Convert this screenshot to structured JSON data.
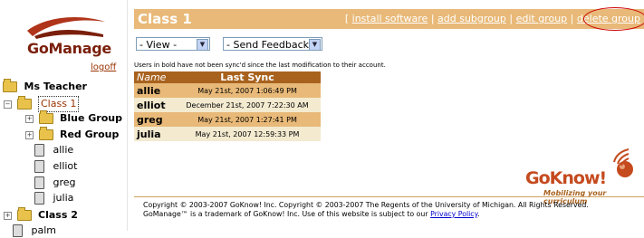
{
  "sidebar": {
    "brand": "GoManage",
    "logoff": "logoff",
    "tree": {
      "root": "Ms Teacher",
      "class1": "Class 1",
      "blue_group": "Blue Group",
      "red_group": "Red Group",
      "students": [
        "allie",
        "elliot",
        "greg",
        "julia"
      ],
      "class2": "Class 2",
      "palm": "palm"
    }
  },
  "header": {
    "title": "Class 1",
    "links": [
      "install software",
      "add subgroup",
      "edit group",
      "delete group"
    ],
    "separator": "|",
    "open_bracket": "[",
    "colors": {
      "bar": "#e8b978",
      "highlight_circle": "#cc0000"
    }
  },
  "controls": {
    "view_select": "- View -",
    "feedback_select": "- Send Feedback -"
  },
  "note": "Users in bold have not been sync'd since the last modification to their account.",
  "table": {
    "headers": [
      "Name",
      "Last Sync"
    ],
    "rows": [
      {
        "name": "allie",
        "last_sync": "May 21st, 2007 1:06:49 PM"
      },
      {
        "name": "elliot",
        "last_sync": "December 21st, 2007 7:22:30 AM"
      },
      {
        "name": "greg",
        "last_sync": "May 21st, 2007 1:27:41 PM"
      },
      {
        "name": "julia",
        "last_sync": "May 21st, 2007 12:59:33 PM"
      }
    ]
  },
  "footer": {
    "logo_text": "GoKnow!",
    "tagline": "Mobilizing your curriculum",
    "copyright_line1": "Copyright © 2003-2007 GoKnow! Inc. Copyright © 2003-2007 The Regents of the University of Michigan. All Rights Reserved.",
    "copyright_line2_prefix": "GoManage™ is a trademark of GoKnow! Inc. Use of this website is subject to our ",
    "privacy_link": "Privacy Policy",
    "copyright_line2_suffix": "."
  }
}
